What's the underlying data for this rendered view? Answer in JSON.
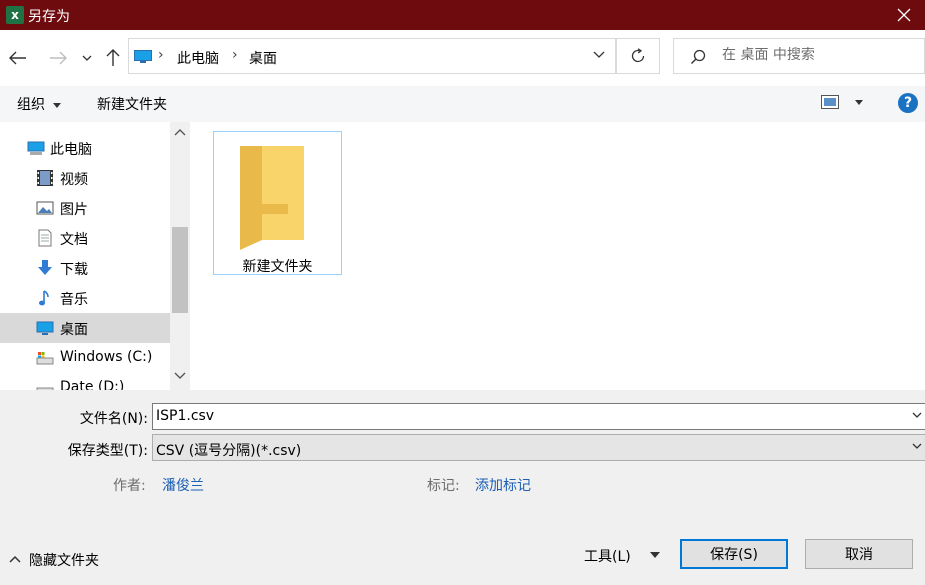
{
  "window": {
    "title": "另存为",
    "app_icon_letter": "x"
  },
  "address": {
    "crumbs": [
      "此电脑",
      "桌面"
    ]
  },
  "search": {
    "placeholder": "在 桌面 中搜索"
  },
  "toolbar": {
    "organize": "组织",
    "new_folder": "新建文件夹",
    "help": "?"
  },
  "sidebar": {
    "items": [
      {
        "label": "此电脑",
        "icon": "computer-icon"
      },
      {
        "label": "视频",
        "icon": "video-icon"
      },
      {
        "label": "图片",
        "icon": "picture-icon"
      },
      {
        "label": "文档",
        "icon": "document-icon"
      },
      {
        "label": "下载",
        "icon": "download-icon"
      },
      {
        "label": "音乐",
        "icon": "music-icon"
      },
      {
        "label": "桌面",
        "icon": "desktop-icon",
        "selected": true
      },
      {
        "label": "Windows (C:)",
        "icon": "drive-icon"
      },
      {
        "label": "Date (D:)",
        "icon": "drive-icon"
      }
    ]
  },
  "content": {
    "items": [
      {
        "label": "新建文件夹",
        "icon": "folder-icon"
      }
    ]
  },
  "form": {
    "filename_label": "文件名(N):",
    "filename_value": "ISP1.csv",
    "filetype_label": "保存类型(T):",
    "filetype_value": "CSV (逗号分隔)(*.csv)",
    "author_label": "作者:",
    "author_value": "潘俊兰",
    "tags_label": "标记:",
    "tags_value": "添加标记"
  },
  "footer": {
    "hide_folders": "隐藏文件夹",
    "tools": "工具(L)",
    "save": "保存(S)",
    "cancel": "取消"
  },
  "colors": {
    "titlebar": "#6e0b0f",
    "accent": "#0078d7",
    "link": "#1a5fb4",
    "selected": "#d9d9d9"
  }
}
